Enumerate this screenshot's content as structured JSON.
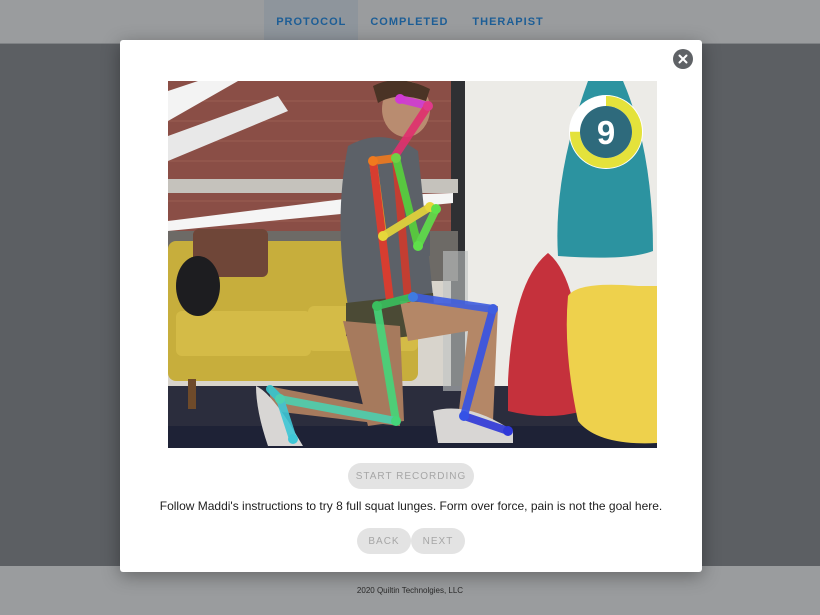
{
  "nav": {
    "tabs": [
      {
        "label": "PROTOCOL",
        "active": true
      },
      {
        "label": "COMPLETED",
        "active": false
      },
      {
        "label": "THERAPIST",
        "active": false
      }
    ]
  },
  "modal": {
    "countdown": "9",
    "countdown_progress": 0.75,
    "record_button": "START RECORDING",
    "instructions": "Follow Maddi's instructions to try 8 full squat lunges. Form over force, pain is not the goal here.",
    "back_button": "BACK",
    "next_button": "NEXT",
    "close_icon": "close-icon"
  },
  "footer": {
    "text": "2020 Quiltin Technolgies, LLC"
  },
  "colors": {
    "nav_text": "#1d5e96",
    "countdown_ring": "#e4e23b",
    "countdown_bg": "#2e6a7c",
    "disabled_button": "#e3e3e3"
  }
}
